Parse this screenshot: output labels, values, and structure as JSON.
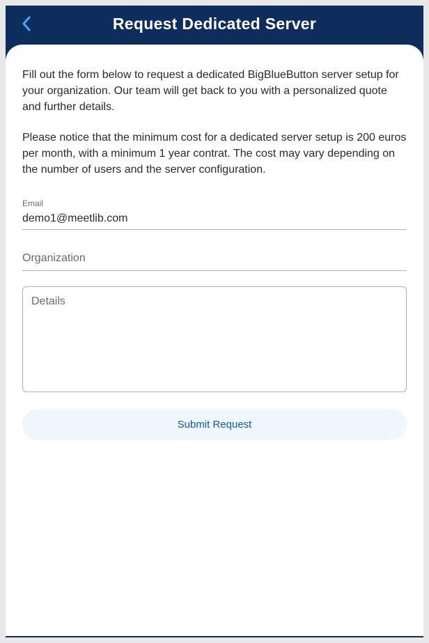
{
  "header": {
    "title": "Request Dedicated Server"
  },
  "intro": {
    "paragraph1": "Fill out the form below to request a dedicated BigBlueButton server setup for your organization. Our team will get back to you with a personalized quote and further details.",
    "paragraph2": "Please notice that the minimum cost for a dedicated server setup is 200 euros per month, with a minimum 1 year contrat. The cost may vary depending on the number of users and the server configuration."
  },
  "form": {
    "email_label": "Email",
    "email_value": "demo1@meetlib.com",
    "organization_placeholder": "Organization",
    "organization_value": "",
    "details_placeholder": "Details",
    "details_value": "",
    "submit_label": "Submit Request"
  }
}
